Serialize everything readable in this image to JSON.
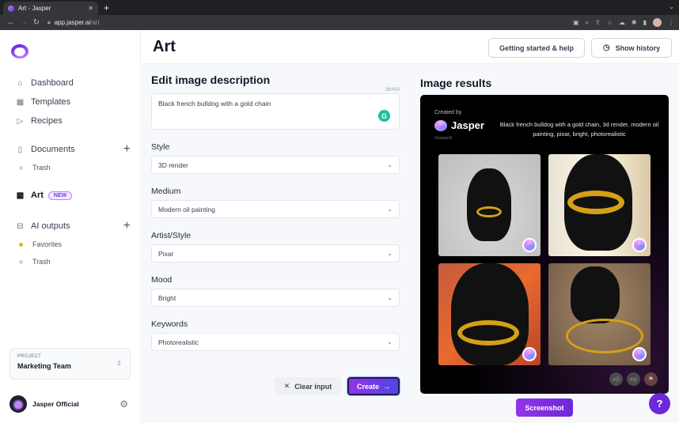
{
  "browser": {
    "tab_title": "Art - Jasper",
    "url_domain": "app.jasper.ai",
    "url_path": "/art"
  },
  "sidebar": {
    "nav": [
      {
        "label": "Dashboard",
        "icon": "home-icon"
      },
      {
        "label": "Templates",
        "icon": "grid-icon"
      },
      {
        "label": "Recipes",
        "icon": "play-box-icon"
      }
    ],
    "documents": {
      "label": "Documents",
      "children": [
        {
          "label": "Trash"
        }
      ]
    },
    "art": {
      "label": "Art",
      "badge": "NEW"
    },
    "ai_outputs": {
      "label": "AI outputs",
      "children": [
        {
          "label": "Favorites"
        },
        {
          "label": "Trash"
        }
      ]
    },
    "project": {
      "label": "PROJECT",
      "value": "Marketing Team"
    },
    "user": {
      "name": "Jasper Official"
    }
  },
  "header": {
    "title": "Art",
    "help_button": "Getting started & help",
    "history_button": "Show history"
  },
  "form": {
    "title": "Edit image description",
    "counter": "38/400",
    "description": "Black french bulldog with a gold chain",
    "fields": [
      {
        "label": "Style",
        "value": "3D render"
      },
      {
        "label": "Medium",
        "value": "Modern oil painting"
      },
      {
        "label": "Artist/Style",
        "value": "Pixar"
      },
      {
        "label": "Mood",
        "value": "Bright"
      },
      {
        "label": "Keywords",
        "value": "Photorealistic"
      }
    ],
    "clear_button": "Clear input",
    "create_button": "Create"
  },
  "results": {
    "title": "Image results",
    "created_by": "Created by",
    "brand": "Jasper",
    "hashtag": "#JasperAI",
    "prompt": "Black french bulldog with a gold chain, 3d render, modern oil painting, pixar, bright, photorealistic",
    "images": [
      {
        "alt": "black french bulldog with gold chain on grey background"
      },
      {
        "alt": "black french bulldog with thick gold chain on cream background"
      },
      {
        "alt": "black french bulldog with gold chain and heart pendant on orange background"
      },
      {
        "alt": "black french bulldog standing amid gold chain on brown background"
      }
    ],
    "screenshot_button": "Screenshot"
  },
  "help_fab": "?",
  "colors": {
    "accent": "#6d28d9",
    "create_gradient_start": "#9333ea",
    "create_gradient_end": "#4f46e5"
  }
}
